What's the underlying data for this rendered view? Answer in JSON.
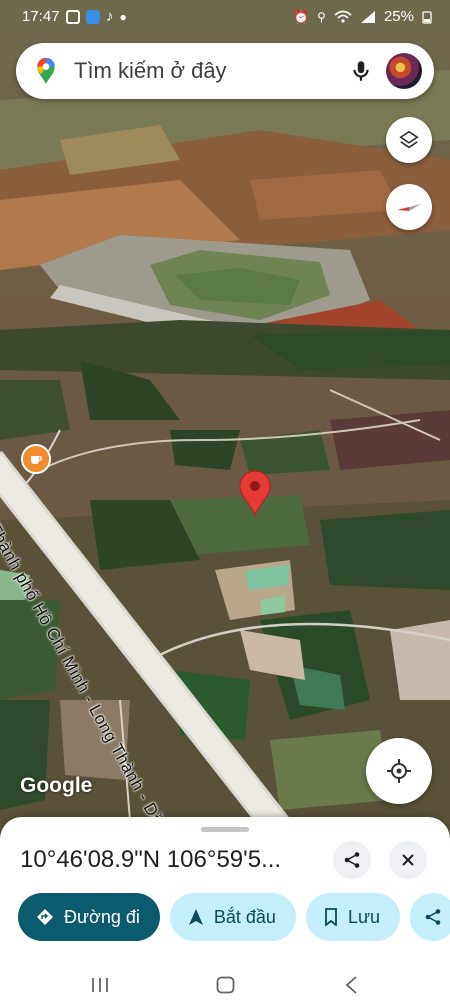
{
  "status_bar": {
    "time": "17:47",
    "battery": "25%",
    "app_icons": [
      "gallery-icon",
      "files-icon",
      "tiktok-icon"
    ],
    "status_icons": [
      "alarm-icon",
      "location-icon",
      "wifi-icon",
      "signal-icon",
      "battery-icon"
    ]
  },
  "search": {
    "placeholder": "Tìm kiếm ở đây"
  },
  "map": {
    "road_label": "Đ. Thành phố Hồ Chí Minh - Long Thành - Dầu Giây",
    "attribution": "Google",
    "pin_color": "#e53935",
    "poi_color": "#f08c2c"
  },
  "sheet": {
    "coordinates": "10°46'08.9\"N 106°59'5...",
    "actions": [
      {
        "label": "Đường đi",
        "icon": "directions-icon"
      },
      {
        "label": "Bắt đầu",
        "icon": "navigation-arrow-icon"
      },
      {
        "label": "Lưu",
        "icon": "bookmark-icon"
      }
    ]
  },
  "colors": {
    "primary_button": "#0b5b6e",
    "secondary_button": "#c4eef9"
  }
}
